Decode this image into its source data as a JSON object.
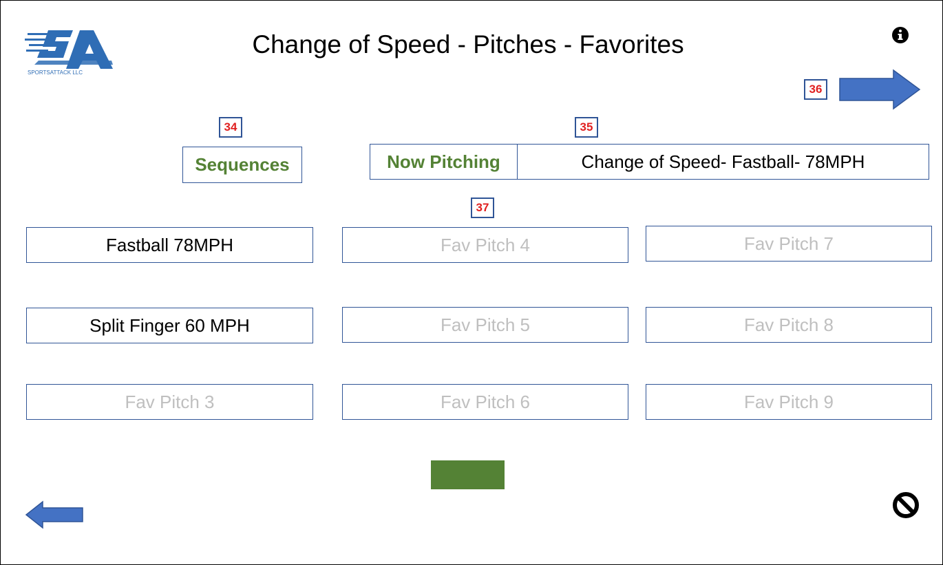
{
  "header": {
    "title": "Change of Speed - Pitches - Favorites",
    "logo_text": "SPORTSATTACK LLC"
  },
  "badges": {
    "sequences": "34",
    "now_pitching": "35",
    "next": "36",
    "pitches": "37"
  },
  "controls": {
    "sequences_label": "Sequences",
    "now_pitching_label": "Now Pitching",
    "now_pitching_value": "Change of Speed- Fastball- 78MPH"
  },
  "pitches": [
    {
      "label": "Fastball 78MPH",
      "state": "set"
    },
    {
      "label": "Split Finger 60 MPH",
      "state": "set"
    },
    {
      "label": "Fav Pitch 3",
      "state": "empty"
    },
    {
      "label": "Fav Pitch 4",
      "state": "empty"
    },
    {
      "label": "Fav Pitch 5",
      "state": "empty"
    },
    {
      "label": "Fav Pitch 6",
      "state": "empty"
    },
    {
      "label": "Fav Pitch 7",
      "state": "empty"
    },
    {
      "label": "Fav Pitch 8",
      "state": "empty"
    },
    {
      "label": "Fav Pitch 9",
      "state": "empty"
    }
  ],
  "icons": {
    "info": "info-icon",
    "next": "arrow-right-icon",
    "back": "arrow-left-icon",
    "cancel": "cancel-icon"
  },
  "colors": {
    "accent_blue": "#4472c4",
    "border_blue": "#2f5496",
    "green": "#548235",
    "badge_red": "#e02020",
    "disabled_text": "#bfbfbf"
  }
}
